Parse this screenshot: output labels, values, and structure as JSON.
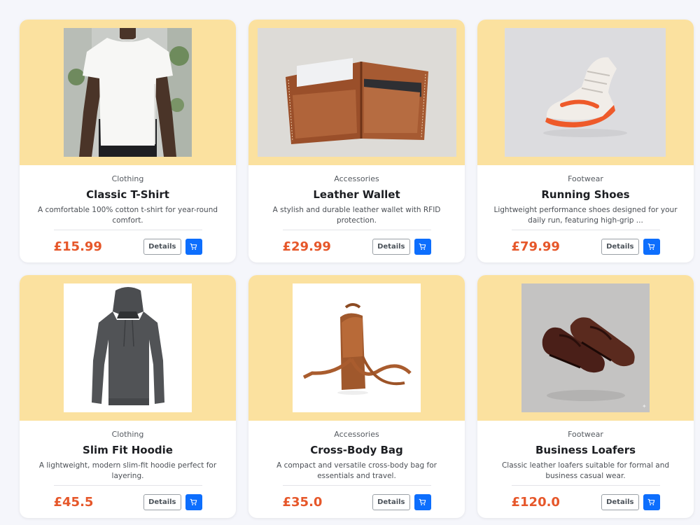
{
  "details_label": "Details",
  "colors": {
    "image_bg": "#fbe19f",
    "price": "#e6572a",
    "cart_button": "#0d6efd"
  },
  "products": [
    {
      "category": "Clothing",
      "name": "Classic T-Shirt",
      "description": "A comfortable 100% cotton t-shirt for year-round comfort.",
      "price": "£15.99",
      "image": "white t-shirt on model"
    },
    {
      "category": "Accessories",
      "name": "Leather Wallet",
      "description": "A stylish and durable leather wallet with RFID protection.",
      "price": "£29.99",
      "image": "brown leather wallet"
    },
    {
      "category": "Footwear",
      "name": "Running Shoes",
      "description": "Lightweight performance shoes designed for your daily run, featuring high-grip ...",
      "price": "£79.99",
      "image": "orange running shoe"
    },
    {
      "category": "Clothing",
      "name": "Slim Fit Hoodie",
      "description": "A lightweight, modern slim-fit hoodie perfect for layering.",
      "price": "£45.5",
      "image": "dark grey hoodie"
    },
    {
      "category": "Accessories",
      "name": "Cross-Body Bag",
      "description": "A compact and versatile cross-body bag for essentials and travel.",
      "price": "£35.0",
      "image": "brown leather cross-body bag"
    },
    {
      "category": "Footwear",
      "name": "Business Loafers",
      "description": "Classic leather loafers suitable for formal and business casual wear.",
      "price": "£120.0",
      "image": "brown leather loafers"
    }
  ]
}
